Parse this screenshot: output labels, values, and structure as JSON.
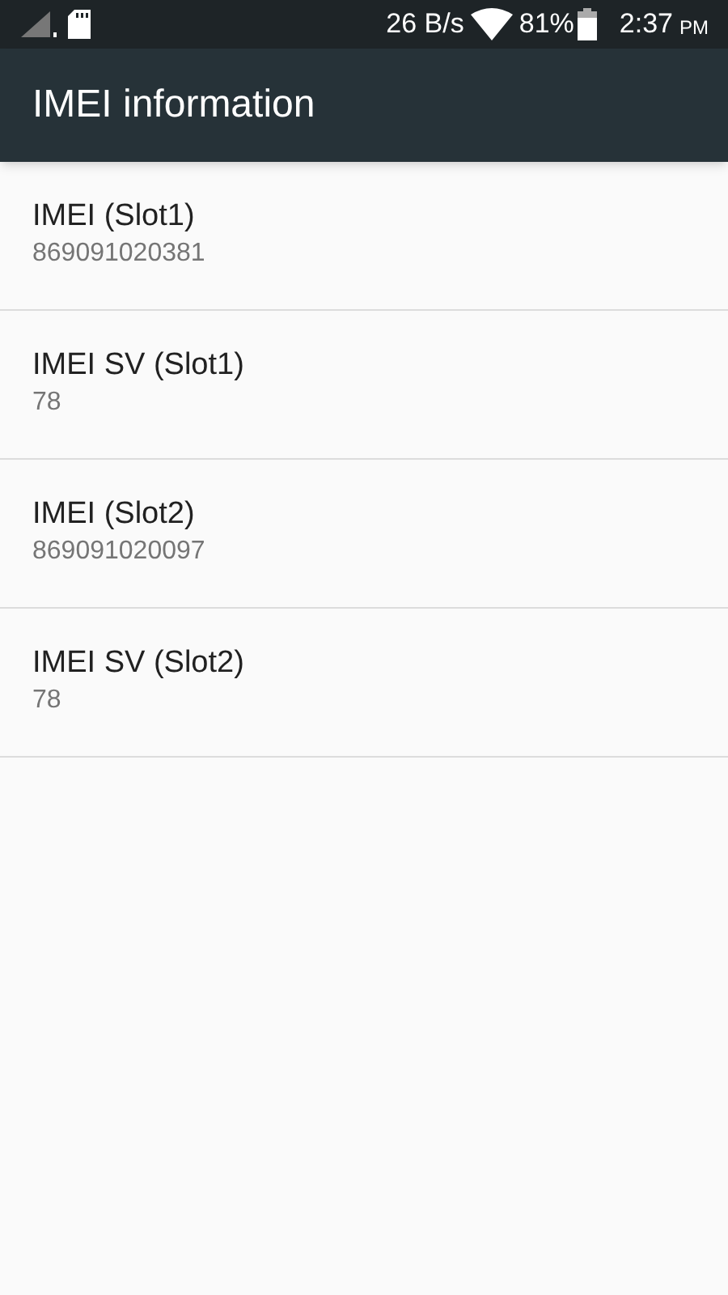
{
  "status_bar": {
    "network_speed": "26 B/s",
    "battery": "81%",
    "time": "2:37",
    "time_suffix": "PM"
  },
  "toolbar": {
    "title": "IMEI information"
  },
  "items": [
    {
      "title": "IMEI (Slot1)",
      "value": "869091020381"
    },
    {
      "title": "IMEI SV (Slot1)",
      "value": "78"
    },
    {
      "title": "IMEI (Slot2)",
      "value": "869091020097"
    },
    {
      "title": "IMEI SV (Slot2)",
      "value": "78"
    }
  ]
}
